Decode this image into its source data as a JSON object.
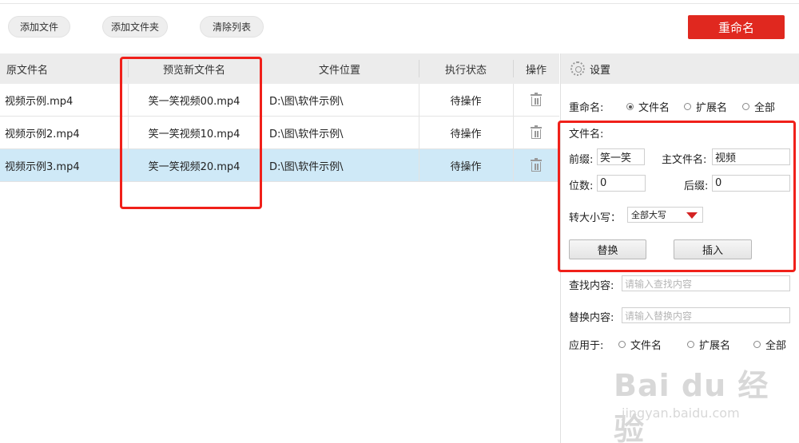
{
  "toolbar": {
    "add_file": "添加文件",
    "add_folder": "添加文件夹",
    "clear_list": "清除列表",
    "rename": "重命名"
  },
  "table": {
    "headers": {
      "original": "原文件名",
      "preview": "预览新文件名",
      "location": "文件位置",
      "status": "执行状态",
      "action": "操作"
    },
    "rows": [
      {
        "original": "视频示例.mp4",
        "preview": "笑一笑视频00.mp4",
        "location": "D:\\图\\软件示例\\",
        "status": "待操作"
      },
      {
        "original": "视频示例2.mp4",
        "preview": "笑一笑视频10.mp4",
        "location": "D:\\图\\软件示例\\",
        "status": "待操作"
      },
      {
        "original": "视频示例3.mp4",
        "preview": "笑一笑视频20.mp4",
        "location": "D:\\图\\软件示例\\",
        "status": "待操作"
      }
    ]
  },
  "settings": {
    "title": "设置",
    "rename_label": "重命名:",
    "rename_options": [
      "文件名",
      "扩展名",
      "全部"
    ],
    "rename_selected": "文件名",
    "filename_label": "文件名:",
    "prefix_label": "前缀:",
    "prefix_value": "笑一笑",
    "main_label": "主文件名:",
    "main_value": "视频",
    "digits_label": "位数:",
    "digits_value": "0",
    "suffix_label": "后缀:",
    "suffix_value": "0",
    "case_label": "转大小写：",
    "case_value": "全部大写",
    "replace_button": "替换",
    "insert_button": "插入",
    "find_label": "查找内容:",
    "find_placeholder": "请输入查找内容",
    "replace_label": "替换内容:",
    "replace_placeholder": "请输入替换内容",
    "apply_label": "应用于:",
    "apply_options": [
      "文件名",
      "扩展名",
      "全部"
    ]
  },
  "watermark": {
    "brand": "Bai du 经验",
    "url": "jingyan.baidu.com"
  },
  "colors": {
    "accent": "#e0281f",
    "highlight_box": "#f0201a",
    "selected_row": "#cfe9f7"
  }
}
